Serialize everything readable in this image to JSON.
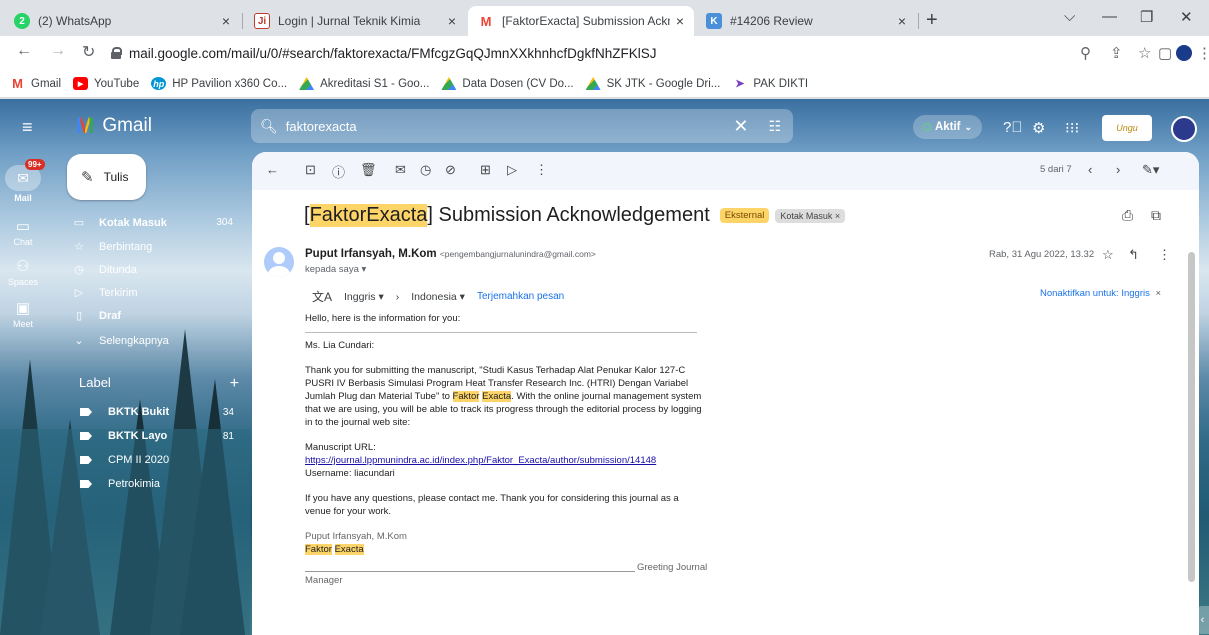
{
  "browser": {
    "tabs": [
      {
        "label": "(2) WhatsApp",
        "close": "×"
      },
      {
        "label": "Login | Jurnal Teknik Kimia",
        "close": "×"
      },
      {
        "label": "[FaktorExacta] Submission Acknowledgement",
        "close": "×"
      },
      {
        "label": "#14206 Review",
        "close": "×"
      }
    ],
    "whatsapp_badge": "2",
    "new_tab": "+",
    "url": "mail.google.com/mail/u/0/#search/faktorexacta/FMfcgzGqQJmnXXkhnhcfDgkfNhZFKlSJ",
    "bookmarks": [
      "Gmail",
      "YouTube",
      "HP Pavilion x360 Co...",
      "Akreditasi S1 - Goo...",
      "Data Dosen (CV Do...",
      "SK JTK - Google Dri...",
      "PAK DIKTI"
    ]
  },
  "gmail": {
    "logo_text": "Gmail",
    "search_value": "faktorexacta",
    "status": "Aktif",
    "org_logo_text": "Ungu",
    "rail": {
      "mail_label": "Mail",
      "mail_badge": "99+",
      "chat_label": "Chat",
      "spaces_label": "Spaces",
      "meet_label": "Meet"
    },
    "compose_label": "Tulis",
    "nav": [
      {
        "label": "Kotak Masuk",
        "count": "304"
      },
      {
        "label": "Berbintang",
        "count": ""
      },
      {
        "label": "Ditunda",
        "count": ""
      },
      {
        "label": "Terkirim",
        "count": ""
      },
      {
        "label": "Draf",
        "count": ""
      },
      {
        "label": "Selengkapnya",
        "count": ""
      }
    ],
    "labels_title": "Label",
    "labels_add": "+",
    "labels": [
      {
        "label": "BKTK Bukit",
        "count": "34"
      },
      {
        "label": "BKTK Layo",
        "count": "81"
      },
      {
        "label": "CPM II 2020",
        "count": ""
      },
      {
        "label": "Petrokimia",
        "count": ""
      }
    ]
  },
  "message": {
    "pager": "5 dari 7",
    "subject_highlight": "FaktorExacta",
    "subject_prefix": "[",
    "subject_rest": "] Submission Acknowledgement",
    "chip_external": "Eksternal",
    "chip_inbox": "Kotak Masuk ×",
    "sender_name": "Puput Irfansyah, M.Kom",
    "sender_email": "<pengembangjurnalunindra@gmail.com>",
    "to": "kepada saya ▾",
    "date": "Rab, 31 Agu 2022, 13.32",
    "translate": {
      "from": "Inggris ▾",
      "to": "Indonesia ▾",
      "action": "Terjemahkan pesan",
      "disable": "Nonaktifkan untuk: Inggris"
    },
    "body": {
      "intro": "Hello, here is the information for you:",
      "salutation": "Ms. Lia Cundari:",
      "para1_a": "Thank you for submitting the manuscript, \"Studi Kasus Terhadap Alat Penukar Kalor 127-C PUSRI IV Berbasis Simulasi Program Heat Transfer Research Inc. (HTRI) Dengan Variabel Jumlah Plug dan Material Tube\" to ",
      "para1_hl1": "Faktor",
      "para1_hl2": "Exacta",
      "para1_b": ". With the online journal management system that we are using, you will be able to track its progress through the editorial process by logging in to the journal web site:",
      "url_label": "Manuscript URL:",
      "url": "https://journal.lppmunindra.ac.id/index.php/Faktor_Exacta/author/submission/14148",
      "username": "Username: liacundari",
      "para2": "If you have any questions, please contact me. Thank you for considering this journal as a venue for your work.",
      "sig_name": "Puput Irfansyah, M.Kom",
      "sig_hl1": "Faktor",
      "sig_hl2": "Exacta",
      "greeting": "Greeting Journal",
      "manager": "Manager"
    }
  }
}
